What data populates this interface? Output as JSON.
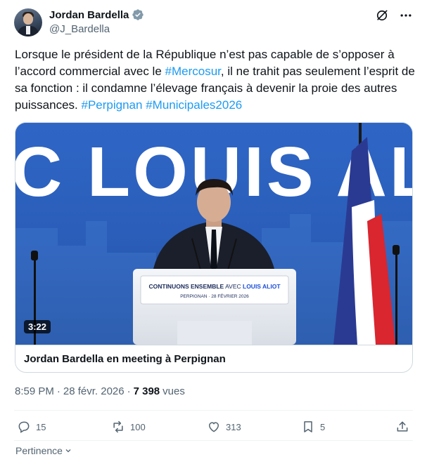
{
  "author": {
    "name": "Jordan Bardella",
    "handle": "@J_Bardella",
    "verified": true,
    "verified_color": "#829aab"
  },
  "tweet": {
    "parts": [
      {
        "text": "Lorsque le président de la République n’est pas capable de s’opposer à l’accord commercial avec le ",
        "type": "text"
      },
      {
        "text": "#Mercosur",
        "type": "hashtag"
      },
      {
        "text": ", il ne trahit pas seulement l’esprit de sa fonction : il condamne l’élevage français à devenir la proie des autres puissances. ",
        "type": "text"
      },
      {
        "text": "#Perpignan",
        "type": "hashtag"
      },
      {
        "text": " ",
        "type": "text"
      },
      {
        "text": "#Municipales2026",
        "type": "hashtag"
      }
    ]
  },
  "media": {
    "backdrop_text": "C LOUIS ALIO",
    "podium_line1_a": "CONTINUONS ENSEMBLE",
    "podium_line1_b": " AVEC ",
    "podium_line1_c": "LOUIS ALIOT",
    "podium_line2": "PERPIGNAN · 28 FÉVRIER 2026",
    "duration": "3:22",
    "caption": "Jordan Bardella en meeting à Perpignan"
  },
  "meta": {
    "time": "8:59 PM",
    "separator": "·",
    "date": "28 févr. 2026",
    "views_count": "7 398",
    "views_label": "vues"
  },
  "actions": {
    "replies": "15",
    "reposts": "100",
    "likes": "313",
    "bookmarks": "5"
  },
  "sort": {
    "label": "Pertinence"
  },
  "colors": {
    "accent": "#1d9bf0",
    "muted": "#536471",
    "text": "#0f1419"
  }
}
